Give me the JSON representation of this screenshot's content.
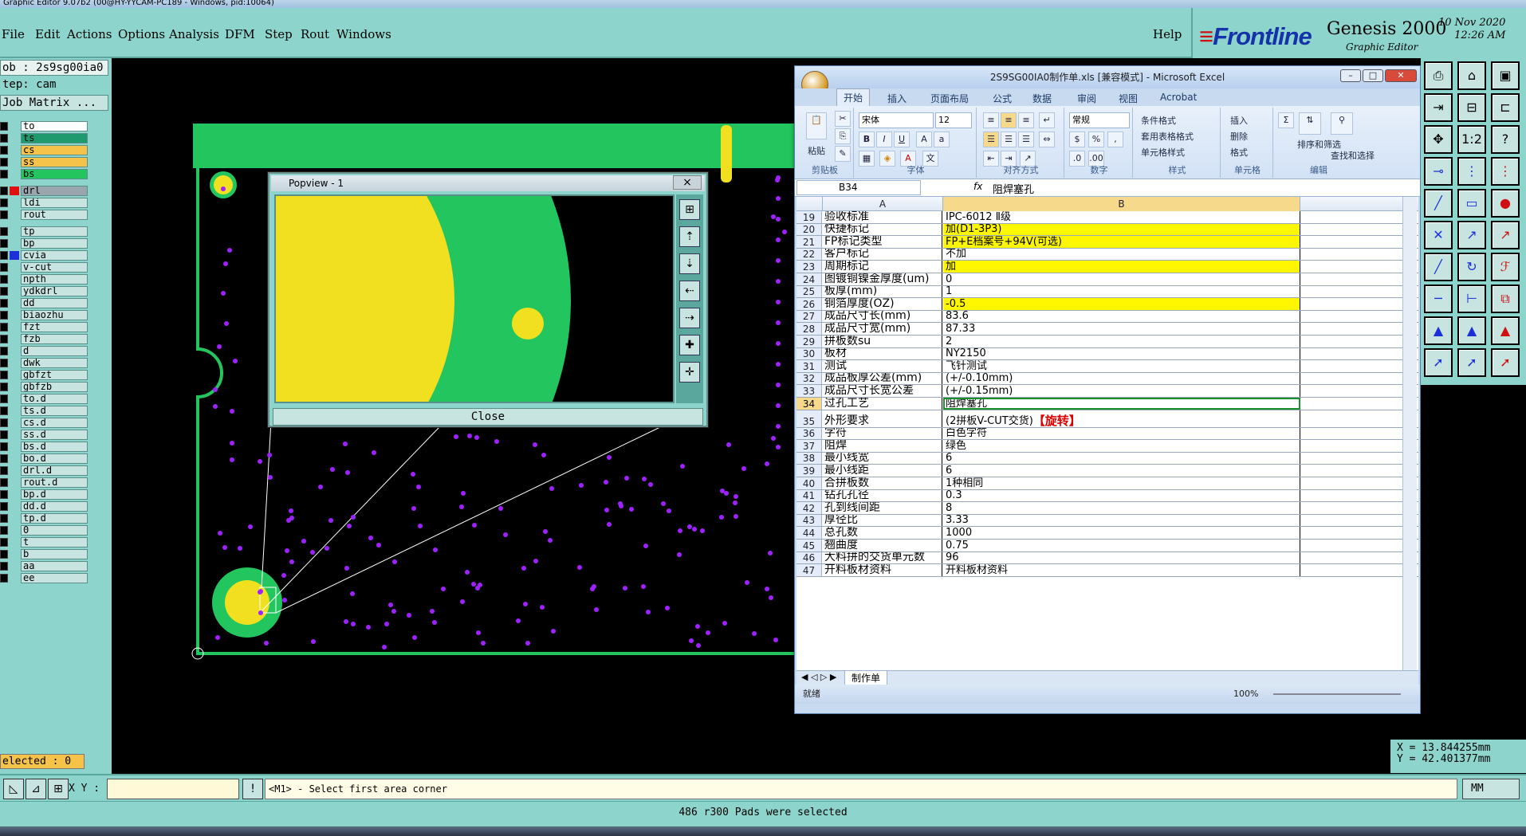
{
  "window": {
    "title": "Graphic Editor 9.07b2 (00@HY-YYCAM-PC189 - Windows, pid:10064)"
  },
  "menu": {
    "items": [
      "File",
      "Edit",
      "Actions",
      "Options",
      "Analysis",
      "DFM",
      "Step",
      "Rout",
      "Windows"
    ],
    "help": "Help"
  },
  "brand": {
    "logo": "Frontline",
    "product": "Genesis 2000",
    "subtitle": "Graphic Editor",
    "date": "10 Nov 2020",
    "time": "12:26 AM"
  },
  "job": {
    "job": "ob : 2s9sg00ia0",
    "step": "tep: cam",
    "matrix_button": "Job Matrix ..."
  },
  "layers": [
    {
      "name": "to",
      "color": "#ffffff",
      "pen": true
    },
    {
      "name": "ts",
      "color": "#1f9a6e",
      "pen": true
    },
    {
      "name": "cs",
      "color": "#f5c24a",
      "pen": true
    },
    {
      "name": "ss",
      "color": "#f5c24a",
      "pen": true
    },
    {
      "name": "bs",
      "color": "#22c55e",
      "pen": false
    },
    {
      "name": "drl",
      "color": "#9aa6ad",
      "pen": false
    },
    {
      "name": "ldi",
      "color": "#c8e4e0",
      "pen": false
    },
    {
      "name": "rout",
      "color": "#c8e4e0",
      "pen": false
    },
    {
      "name": "tp",
      "color": "#c8e4e0",
      "pen": false
    },
    {
      "name": "bp",
      "color": "#c8e4e0",
      "pen": false
    },
    {
      "name": "cvia",
      "color": "#c8e4e0",
      "pen": false
    },
    {
      "name": "v-cut",
      "color": "#c8e4e0",
      "pen": false
    },
    {
      "name": "npth",
      "color": "#c8e4e0",
      "pen": false
    },
    {
      "name": "ydkdrl",
      "color": "#c8e4e0",
      "pen": false
    },
    {
      "name": "dd",
      "color": "#c8e4e0",
      "pen": false
    },
    {
      "name": "biaozhu",
      "color": "#c8e4e0",
      "pen": false
    },
    {
      "name": "fzt",
      "color": "#c8e4e0",
      "pen": false
    },
    {
      "name": "fzb",
      "color": "#c8e4e0",
      "pen": false
    },
    {
      "name": "d",
      "color": "#c8e4e0",
      "pen": false
    },
    {
      "name": "dwk",
      "color": "#c8e4e0",
      "pen": false
    },
    {
      "name": "gbfzt",
      "color": "#c8e4e0",
      "pen": false
    },
    {
      "name": "gbfzb",
      "color": "#c8e4e0",
      "pen": false
    },
    {
      "name": "to.d",
      "color": "#c8e4e0",
      "pen": true
    },
    {
      "name": "ts.d",
      "color": "#c8e4e0",
      "pen": true
    },
    {
      "name": "cs.d",
      "color": "#c8e4e0",
      "pen": true
    },
    {
      "name": "ss.d",
      "color": "#c8e4e0",
      "pen": true
    },
    {
      "name": "bs.d",
      "color": "#c8e4e0",
      "pen": false
    },
    {
      "name": "bo.d",
      "color": "#c8e4e0",
      "pen": false
    },
    {
      "name": "drl.d",
      "color": "#c8e4e0",
      "pen": false
    },
    {
      "name": "rout.d",
      "color": "#c8e4e0",
      "pen": false
    },
    {
      "name": "bp.d",
      "color": "#c8e4e0",
      "pen": false
    },
    {
      "name": "dd.d",
      "color": "#c8e4e0",
      "pen": false
    },
    {
      "name": "tp.d",
      "color": "#c8e4e0",
      "pen": false
    },
    {
      "name": "0",
      "color": "#c8e4e0",
      "pen": false
    },
    {
      "name": "t",
      "color": "#c8e4e0",
      "pen": false
    },
    {
      "name": "b",
      "color": "#c8e4e0",
      "pen": false
    },
    {
      "name": "aa",
      "color": "#c8e4e0",
      "pen": false
    },
    {
      "name": "ee",
      "color": "#c8e4e0",
      "pen": false
    }
  ],
  "selected_count": "elected : 0",
  "popview": {
    "title": "Popview - 1",
    "close_label": "Close",
    "close_x": "×"
  },
  "excel": {
    "title": "2S9SG00IA0制作单.xls  [兼容模式] - Microsoft Excel",
    "tabs": [
      "开始",
      "插入",
      "页面布局",
      "公式",
      "数据",
      "审阅",
      "视图",
      "Acrobat"
    ],
    "font": "宋体",
    "font_size": "12",
    "number_format": "常规",
    "groups": [
      "剪贴板",
      "字体",
      "对齐方式",
      "数字",
      "样式",
      "单元格",
      "编辑"
    ],
    "paste": "粘贴",
    "styles": [
      "条件格式",
      "套用表格格式",
      "单元格样式"
    ],
    "cells_cmds": [
      "插入",
      "删除",
      "格式"
    ],
    "edit_cmds": [
      "排序和筛选",
      "查找和选择"
    ],
    "name_box": "B34",
    "fx": "fx",
    "formula": "阻焊塞孔",
    "columns": [
      "A",
      "B"
    ],
    "rows": [
      {
        "n": "19",
        "a": "验收标准",
        "b": "IPC-6012 Ⅱ级",
        "hl": false
      },
      {
        "n": "20",
        "a": "快捷标记",
        "b": "加(D1-3P3)",
        "hl": true
      },
      {
        "n": "21",
        "a": "FP标记类型",
        "b": "FP+E档案号+94V(可选)",
        "hl": true
      },
      {
        "n": "22",
        "a": "客户标记",
        "b": "不加",
        "hl": false
      },
      {
        "n": "23",
        "a": "周期标记",
        "b": "加",
        "hl": true
      },
      {
        "n": "24",
        "a": "图镀铜镍金厚度(um)",
        "b": "0",
        "hl": false
      },
      {
        "n": "25",
        "a": "板厚(mm)",
        "b": "1",
        "hl": false
      },
      {
        "n": "26",
        "a": "铜箔厚度(OZ)",
        "b": "-0.5",
        "hl": true
      },
      {
        "n": "27",
        "a": "成品尺寸长(mm)",
        "b": "83.6",
        "hl": false
      },
      {
        "n": "28",
        "a": "成品尺寸宽(mm)",
        "b": "87.33",
        "hl": false
      },
      {
        "n": "29",
        "a": "拼板数su",
        "b": "2",
        "hl": false
      },
      {
        "n": "30",
        "a": "板材",
        "b": "NY2150",
        "hl": false
      },
      {
        "n": "31",
        "a": "测试",
        "b": "飞针测试",
        "hl": false
      },
      {
        "n": "32",
        "a": "成品板厚公差(mm)",
        "b": "(+/-0.10mm)",
        "hl": false
      },
      {
        "n": "33",
        "a": "成品尺寸长宽公差",
        "b": "(+/-0.15mm)",
        "hl": false
      },
      {
        "n": "34",
        "a": "过孔工艺",
        "b": "阻焊塞孔",
        "hl": false
      },
      {
        "n": "35",
        "a": "外形要求",
        "b": "(2拼板V-CUT交货)",
        "b_red": "【旋转】",
        "hl": false
      },
      {
        "n": "36",
        "a": "字符",
        "b": "白色字符",
        "hl": false
      },
      {
        "n": "37",
        "a": "阻焊",
        "b": "绿色",
        "hl": false
      },
      {
        "n": "38",
        "a": "最小线宽",
        "b": "6",
        "hl": false
      },
      {
        "n": "39",
        "a": "最小线距",
        "b": "6",
        "hl": false
      },
      {
        "n": "40",
        "a": "合拼板数",
        "b": "1种相同",
        "hl": false
      },
      {
        "n": "41",
        "a": "钻孔孔径",
        "b": "0.3",
        "hl": false
      },
      {
        "n": "42",
        "a": "孔到线间距",
        "b": "8",
        "hl": false
      },
      {
        "n": "43",
        "a": "厚径比",
        "b": "3.33",
        "hl": false
      },
      {
        "n": "44",
        "a": "总孔数",
        "b": "1000",
        "hl": false
      },
      {
        "n": "45",
        "a": "翘曲度",
        "b": "0.75",
        "hl": false
      },
      {
        "n": "46",
        "a": "大料拼的交货单元数",
        "b": "96",
        "hl": false
      },
      {
        "n": "47",
        "a": "开料板材资料",
        "b": "开料板材资料",
        "hl": false
      }
    ],
    "sheet_tab": "制作单",
    "status": "就绪",
    "zoom": "100%"
  },
  "coords": {
    "x": "X = 13.844255mm",
    "y": "Y = 42.401377mm"
  },
  "bottom": {
    "xy_label": "X Y :",
    "prompt": "<M1> - Select first area corner",
    "units": "MM"
  },
  "status_message": "486 r300 Pads were selected"
}
